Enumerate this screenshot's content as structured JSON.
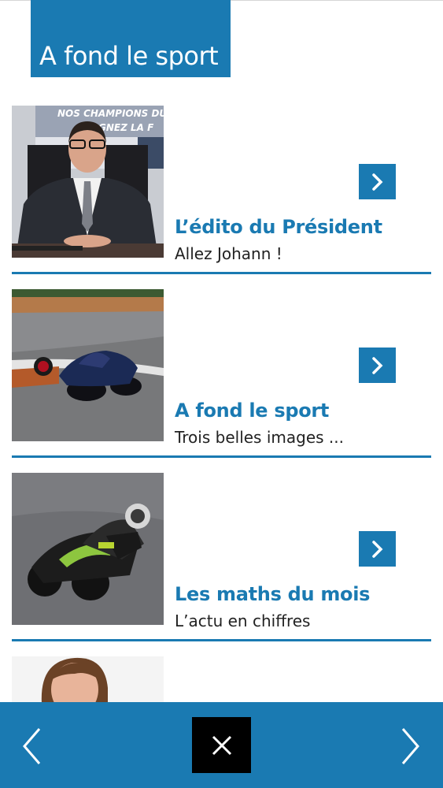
{
  "header": {
    "title": "A fond le sport"
  },
  "articles": [
    {
      "title": "L’édito du Président",
      "subtitle": "Allez Johann !",
      "banner_text": "NOS CHAMPIONS DU",
      "banner_text_2": "GNEZ LA F",
      "open_icon": "chevron-right-icon"
    },
    {
      "title": "A fond le sport",
      "subtitle": "Trois belles images ...",
      "open_icon": "chevron-right-icon"
    },
    {
      "title": "Les maths du mois",
      "subtitle": "L’actu en chiffres",
      "open_icon": "chevron-right-icon"
    }
  ],
  "bottom_bar": {
    "prev_icon": "chevron-left-icon",
    "close_icon": "close-icon",
    "next_icon": "chevron-right-icon"
  },
  "colors": {
    "accent": "#1a7ab2",
    "close_bg": "#000000",
    "text": "#222222"
  }
}
